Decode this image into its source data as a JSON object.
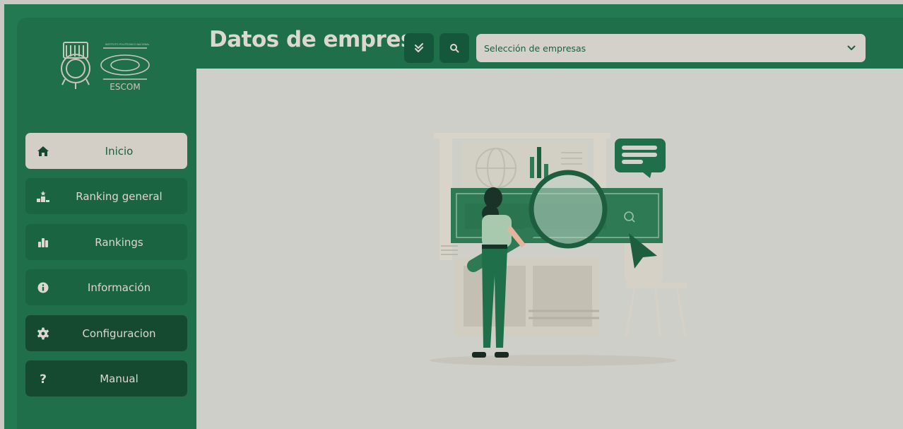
{
  "header": {
    "title": "Datos de empres",
    "check_button": {
      "icon": "double-check-icon"
    },
    "search_button": {
      "icon": "search-icon"
    },
    "select": {
      "value": "Selección de empresas",
      "icon": "chevron-down-icon"
    }
  },
  "logo": {
    "text": "ESCOM",
    "institute": "IPN"
  },
  "sidebar": {
    "items": [
      {
        "label": "Inicio",
        "icon": "home-icon"
      },
      {
        "label": "Ranking general",
        "icon": "podium-icon"
      },
      {
        "label": "Rankings",
        "icon": "bar-chart-icon"
      },
      {
        "label": "Información",
        "icon": "info-icon"
      },
      {
        "label": "Configuracion",
        "icon": "gear-icon"
      },
      {
        "label": "Manual",
        "icon": "question-icon"
      }
    ]
  },
  "colors": {
    "primary": "#1f6f4a",
    "dark": "#154a31",
    "accent_light": "#d4cfc6",
    "content_bg": "#cfcfca"
  }
}
